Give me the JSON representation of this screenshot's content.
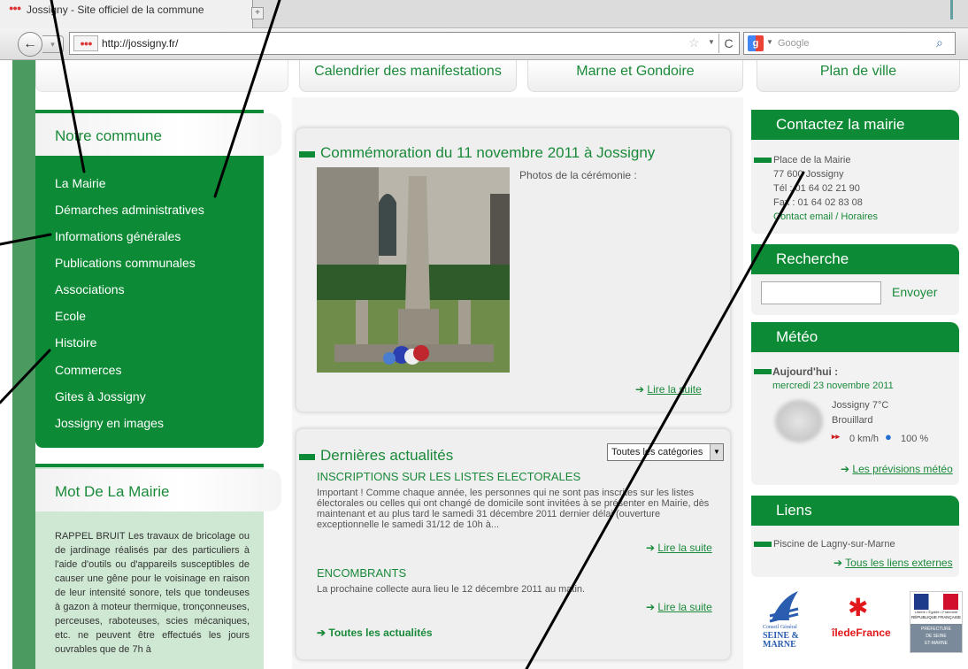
{
  "browser": {
    "tab_title": "Jossigny - Site officiel de la commune",
    "favicon": "●●●",
    "url": "http://jossigny.fr/",
    "search_engine": "Google"
  },
  "top_nav": {
    "items": [
      "Calendrier des manifestations",
      "Marne et Gondoire",
      "Plan de ville"
    ]
  },
  "left_menu": {
    "title": "Notre commune",
    "items": [
      "La Mairie",
      "Démarches administratives",
      "Informations générales",
      "Publications communales",
      "Associations",
      "Ecole",
      "Histoire",
      "Commerces",
      "Gites à Jossigny",
      "Jossigny en images"
    ]
  },
  "mot": {
    "title": "Mot De La Mairie",
    "text": "RAPPEL BRUIT Les travaux de bricolage ou de jardinage réalisés par des particuliers à l'aide d'outils ou d'appareils susceptibles de causer une gêne pour le voisinage en raison de leur intensité sonore, tels que tondeuses à gazon à moteur thermique, tronçonneuses, perceuses, raboteuses, scies mécaniques, etc. ne peuvent être effectués les jours ouvrables que de 7h à"
  },
  "featured": {
    "title": "Commémoration du 11 novembre 2011 à Jossigny",
    "caption": "Photos de la cérémonie :",
    "read_more": "Lire la suite"
  },
  "news": {
    "title": "Dernières actualités",
    "category_select": "Toutes les catégories",
    "items": [
      {
        "title": "INSCRIPTIONS SUR LES LISTES ELECTORALES",
        "body": "Important ! Comme chaque année, les personnes qui ne sont pas inscrites sur les listes électorales ou celles qui ont changé de domicile sont invitées à se présenter en Mairie, dès maintenant et au plus tard le samedi 31 décembre 2011 dernier délai (ouverture exceptionnelle le samedi 31/12 de 10h à...",
        "read_more": "Lire la suite"
      },
      {
        "title": "ENCOMBRANTS",
        "body": "La prochaine collecte aura lieu le 12 décembre 2011 au matin.",
        "read_more": "Lire la suite"
      }
    ],
    "all_link": "Toutes les actualités"
  },
  "contact": {
    "title": "Contactez la mairie",
    "lines": [
      "Place de la Mairie",
      "77 600 Jossigny",
      "Tél : 01 64 02 21 90",
      "Fax : 01 64 02 83 08"
    ],
    "link": "Contact email / Horaires"
  },
  "search": {
    "title": "Recherche",
    "button": "Envoyer"
  },
  "weather": {
    "title": "Météo",
    "today_label": "Aujourd'hui :",
    "date": "mercredi 23 novembre 2011",
    "place_temp": "Jossigny 7°C",
    "condition": "Brouillard",
    "wind": "0 km/h",
    "humidity": "100 %",
    "forecast_link": "Les prévisions météo"
  },
  "links": {
    "title": "Liens",
    "item": "Piscine de Lagny-sur-Marne",
    "all_link": "Tous les liens externes"
  },
  "logos": {
    "seine_marne": [
      "Conseil Général",
      "SEINE &",
      "MARNE"
    ],
    "idf": "îledeFrance",
    "pref": [
      "Liberté • Égalité • Fraternité",
      "RÉPUBLIQUE FRANÇAISE",
      "PRÉFECTURE",
      "DE SEINE",
      "ET-MARNE"
    ]
  },
  "colors": {
    "brand_green": "#0c8a35",
    "link_green": "#1a8a3a",
    "strip_green": "#4b9a5f"
  }
}
